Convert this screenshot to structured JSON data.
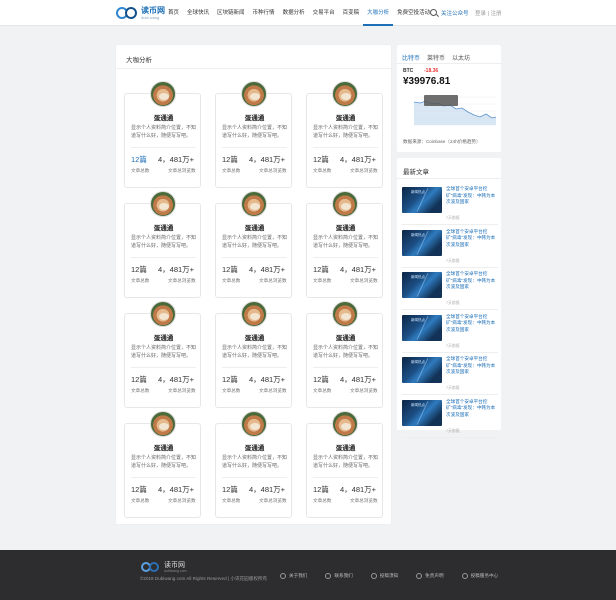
{
  "header": {
    "logo_cn": "读币网",
    "logo_en": "dubi wang",
    "nav": [
      "首页",
      "全球快讯",
      "区块链新闻",
      "币种行情",
      "数据分析",
      "交易平台",
      "百变稿",
      "大咖分析",
      "免费空投活动"
    ],
    "active_nav": "大咖分析",
    "follow": "关注公众号",
    "auth": "登录 | 注册"
  },
  "main": {
    "title": "大咖分析",
    "authors": [
      {
        "name": "蛋通通",
        "desc": "显示个人资料简介位置，不知道写什么好，随便写写吧。",
        "count": "12篇",
        "views": "4，481万+",
        "count_label": "文章总数",
        "views_label": "文章总浏览数"
      },
      {
        "name": "蛋通通",
        "desc": "显示个人资料简介位置，不知道写什么好，随便写写吧。",
        "count": "12篇",
        "views": "4，481万+",
        "count_label": "文章总数",
        "views_label": "文章总浏览数"
      },
      {
        "name": "蛋通通",
        "desc": "显示个人资料简介位置，不知道写什么好，随便写写吧。",
        "count": "12篇",
        "views": "4，481万+",
        "count_label": "文章总数",
        "views_label": "文章总浏览数"
      },
      {
        "name": "蛋通通",
        "desc": "显示个人资料简介位置，不知道写什么好，随便写写吧。",
        "count": "12篇",
        "views": "4，481万+",
        "count_label": "文章总数",
        "views_label": "文章总浏览数"
      },
      {
        "name": "蛋通通",
        "desc": "显示个人资料简介位置，不知道写什么好，随便写写吧。",
        "count": "12篇",
        "views": "4，481万+",
        "count_label": "文章总数",
        "views_label": "文章总浏览数"
      },
      {
        "name": "蛋通通",
        "desc": "显示个人资料简介位置，不知道写什么好，随便写写吧。",
        "count": "12篇",
        "views": "4，481万+",
        "count_label": "文章总数",
        "views_label": "文章总浏览数"
      },
      {
        "name": "蛋通通",
        "desc": "显示个人资料简介位置，不知道写什么好，随便写写吧。",
        "count": "12篇",
        "views": "4，481万+",
        "count_label": "文章总数",
        "views_label": "文章总浏览数"
      },
      {
        "name": "蛋通通",
        "desc": "显示个人资料简介位置，不知道写什么好，随便写写吧。",
        "count": "12篇",
        "views": "4，481万+",
        "count_label": "文章总数",
        "views_label": "文章总浏览数"
      },
      {
        "name": "蛋通通",
        "desc": "显示个人资料简介位置，不知道写什么好，随便写写吧。",
        "count": "12篇",
        "views": "4，481万+",
        "count_label": "文章总数",
        "views_label": "文章总浏览数"
      },
      {
        "name": "蛋通通",
        "desc": "显示个人资料简介位置，不知道写什么好，随便写写吧。",
        "count": "12篇",
        "views": "4，481万+",
        "count_label": "文章总数",
        "views_label": "文章总浏览数"
      },
      {
        "name": "蛋通通",
        "desc": "显示个人资料简介位置，不知道写什么好，随便写写吧。",
        "count": "12篇",
        "views": "4，481万+",
        "count_label": "文章总数",
        "views_label": "文章总浏览数"
      },
      {
        "name": "蛋通通",
        "desc": "显示个人资料简介位置，不知道写什么好，随便写写吧。",
        "count": "12篇",
        "views": "4，481万+",
        "count_label": "文章总数",
        "views_label": "文章总浏览数"
      }
    ]
  },
  "btc": {
    "tabs": [
      "比特币",
      "莱特币",
      "以太坊"
    ],
    "symbol": "BTC",
    "change": "-18.36",
    "price": "¥39976.81",
    "source": "数据来源：Coinbase（24h价格趋势）",
    "accent": "#1d6fb8",
    "down_color": "#e33333"
  },
  "news": {
    "heading": "最新文章",
    "items": [
      {
        "tag": "新闻热点",
        "title": "全球首个安卓平台挖矿\"病毒\"发现：中韩为本次波及国家",
        "meta": "7天前报"
      },
      {
        "tag": "新闻热点",
        "title": "全球首个安卓平台挖矿\"病毒\"发现：中韩为本次波及国家",
        "meta": "7天前报"
      },
      {
        "tag": "新闻热点",
        "title": "全球首个安卓平台挖矿\"病毒\"发现：中韩为本次波及国家",
        "meta": "7天前报"
      },
      {
        "tag": "新闻热点",
        "title": "全球首个安卓平台挖矿\"病毒\"发现：中韩为本次波及国家",
        "meta": "7天前报"
      },
      {
        "tag": "新闻热点",
        "title": "全球首个安卓平台挖矿\"病毒\"发现：中韩为本次波及国家",
        "meta": "7天前报"
      },
      {
        "tag": "新闻热点",
        "title": "全球首个安卓平台挖矿\"病毒\"发现：中韩为本次波及国家",
        "meta": "7天前报"
      }
    ]
  },
  "footer": {
    "name": "读币网",
    "en": "dubiwang.com",
    "copyright": "©2018 Dubiwang.com All Rights Reserved | 小讯花园版权所有",
    "links": [
      "关于我们",
      "联系我们",
      "投稿须知",
      "免责声明",
      "投稿服务中心"
    ]
  }
}
